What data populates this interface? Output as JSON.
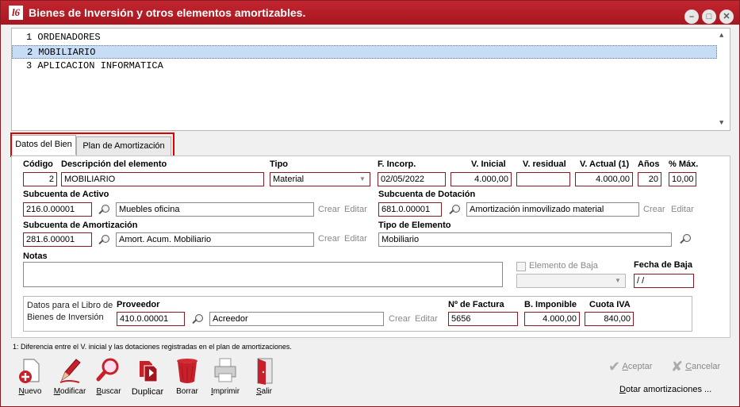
{
  "window": {
    "title": "Bienes de Inversión y otros elementos amortizables.",
    "logo_text": "l6"
  },
  "list": {
    "items": [
      {
        "num": "1",
        "name": "ORDENADORES"
      },
      {
        "num": "2",
        "name": "MOBILIARIO"
      },
      {
        "num": "3",
        "name": "APLICACION INFORMATICA"
      }
    ],
    "selected_index": 1
  },
  "tabs": [
    "Datos del Bien",
    "Plan de Amortización"
  ],
  "form": {
    "codigo_label": "Código",
    "codigo": "2",
    "descripcion_label": "Descripción del elemento",
    "descripcion": "MOBILIARIO",
    "tipo_label": "Tipo",
    "tipo": "Material",
    "fincorp_label": "F. Incorp.",
    "fincorp": "02/05/2022",
    "vinicial_label": "V. Inicial",
    "vinicial": "4.000,00",
    "vresidual_label": "V. residual",
    "vresidual": "",
    "vactual_label": "V. Actual (1)",
    "vactual": "4.000,00",
    "anos_label": "Años",
    "anos": "20",
    "pmax_label": "% Máx.",
    "pmax": "10,00",
    "subactivo_label": "Subcuenta de Activo",
    "subactivo_code": "216.0.00001",
    "subactivo_desc": "Muebles oficina",
    "subdotacion_label": "Subcuenta de Dotación",
    "subdotacion_code": "681.0.00001",
    "subdotacion_desc": "Amortización inmovilizado material",
    "subamort_label": "Subcuenta de Amortización",
    "subamort_code": "281.6.00001",
    "subamort_desc": "Amort. Acum. Mobiliario",
    "tipoelem_label": "Tipo de Elemento",
    "tipoelem": "Mobiliario",
    "notas_label": "Notas",
    "notas": "",
    "baja_label": "Elemento de Baja",
    "fechabaja_label": "Fecha de Baja",
    "fechabaja": " / /",
    "crear": "Crear",
    "editar": "Editar"
  },
  "libro": {
    "group_label_1": "Datos para el Libro de",
    "group_label_2": "Bienes de Inversión",
    "proveedor_label": "Proveedor",
    "proveedor_code": "410.0.00001",
    "proveedor_desc": "Acreedor",
    "factura_label": "Nº de Factura",
    "factura": "5656",
    "bimponible_label": "B. Imponible",
    "bimponible": "4.000,00",
    "cuotaiva_label": "Cuota IVA",
    "cuotaiva": "840,00"
  },
  "footnote": "1: Diferencia entre el V. inicial y las dotaciones registradas en el plan de amortizaciones.",
  "toolbar": {
    "nuevo": "Nuevo",
    "modificar": "Modificar",
    "buscar": "Buscar",
    "duplicar": "Duplicar",
    "borrar": "Borrar",
    "imprimir": "Imprimir",
    "salir": "Salir"
  },
  "actions": {
    "aceptar": "Aceptar",
    "cancelar": "Cancelar",
    "dotar": "Dotar amortizaciones ..."
  },
  "colors": {
    "titlebar": "#a8161f",
    "field_border": "#8a1a22",
    "selection": "#c7ddf6",
    "highlight_box": "#e00000"
  }
}
